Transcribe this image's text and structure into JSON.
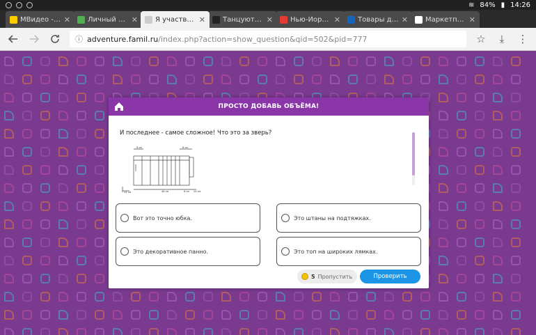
{
  "statusbar": {
    "battery": "84%",
    "time": "14:26"
  },
  "tabs": [
    {
      "title": "МВидео - Пр",
      "color": "#ffcc00",
      "active": false
    },
    {
      "title": "Личный кабине",
      "color": "#4caf50",
      "active": false
    },
    {
      "title": "Я участвую в в",
      "color": "#cccccc",
      "active": true
    },
    {
      "title": "Танцуют все! б",
      "color": "#222222",
      "active": false
    },
    {
      "title": "Нью-Йоркский",
      "color": "#e53935",
      "active": false
    },
    {
      "title": "Товары для ма",
      "color": "#1565c0",
      "active": false
    },
    {
      "title": "Маркетплейс д",
      "color": "#ffffff",
      "active": false
    }
  ],
  "toolbar": {
    "url_host": "adventure.famil.ru",
    "url_path": "/index.php?action=show_question&qid=502&pid=777"
  },
  "dialog": {
    "title": "ПРОСТО ДОБАВЬ ОБЪЁМА!",
    "question": "И последнее - самое сложное! Что это за зверь?",
    "answers": [
      "Вот это точно юбка.",
      "Это штаны на подтяжках.",
      "Это декоративное панно.",
      "Это топ на широких лямках."
    ],
    "skip_count": "5",
    "skip_label": "Пропустить",
    "check_label": "Проверить"
  },
  "colors": {
    "header": "#8a36a8",
    "accent": "#1c95e6",
    "background": "#7a3a8f"
  }
}
